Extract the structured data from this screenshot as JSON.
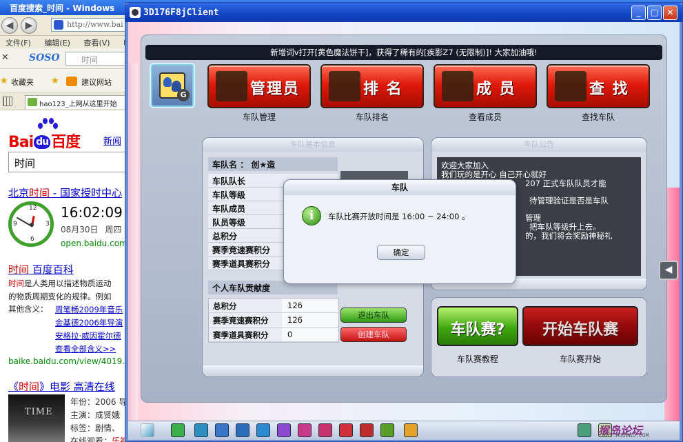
{
  "browser": {
    "title": "百度搜索_时间 - Windows",
    "address": "http://www.bai",
    "menu": [
      "文件(F)",
      "编辑(E)",
      "查看(V)",
      "收"
    ],
    "search_brand": "SOSO",
    "search_value": "时间",
    "favorites_label": "收藏夹",
    "suggested_sites": "建议网站",
    "tab_label": "hao123_上网从这里开始",
    "baidu": {
      "logo_bai": "Bai",
      "logo_du": "du",
      "logo_cn": "百度",
      "news_link": "新闻",
      "query": "时间",
      "result1_prefix": "北京",
      "result1_hl": "时间",
      "result1_rest": " - 国家授时中心",
      "clock_time": "16:02:09",
      "clock_date": "08月30日",
      "clock_weekday": "周四",
      "result1_url": "open.baidu.com",
      "result2_hl": "时间",
      "result2_rest": " 百度百科",
      "result2_line1_hl": "时间",
      "result2_line1": "是人类用以描述物质运动",
      "result2_line2": "的物质周期变化的规律。例如",
      "other_label": "其他含义：",
      "other_items": [
        "周笔畅2009年音乐",
        "金基德2006年导演",
        "安格拉·威因霍尔德"
      ],
      "other_all": "查看全部含义>>",
      "result2_url": "baike.baidu.com/view/4019.ht",
      "result3_prefix": "《",
      "result3_hl": "时间",
      "result3_rest": "》电影 高清在线",
      "poster_text": "TIME",
      "movie_year": "年份：2006 导",
      "movie_cast": "主演：成贤娥",
      "movie_tags": "标签：剧情、",
      "movie_online": "在线观看：",
      "movie_online_tail": "乐视"
    }
  },
  "game": {
    "title": "3D176F8jClient",
    "banner": "新增词v打开[黄色魔法饼干]，获得了稀有的[疾影Z7 (无限制)]! 大家加油哦!",
    "top_buttons": [
      {
        "label": "管理员",
        "caption": "车队管理"
      },
      {
        "label": "排 名",
        "caption": "车队排名"
      },
      {
        "label": "成 员",
        "caption": "查看成员"
      },
      {
        "label": "查 找",
        "caption": "查找车队"
      }
    ],
    "info_panel": {
      "header": "车队基本信息",
      "team_name": "车队名 ： 创★造",
      "rows": [
        "车队队长",
        "车队等级",
        "车队成员",
        "队员等级",
        "总积分",
        "赛季竞速赛积分",
        "赛季道具赛积分"
      ],
      "contrib_header": "个人车队贡献度",
      "contrib": [
        {
          "k": "总积分",
          "v": "126"
        },
        {
          "k": "赛季竞速赛积分",
          "v": "126"
        },
        {
          "k": "赛季道具赛积分",
          "v": "0"
        }
      ],
      "quit_button": "退出车队",
      "create_button": "创建车队"
    },
    "notice_panel": {
      "header": "车队公告",
      "lines": [
        "欢迎大家加入",
        "我们玩的是开心 自己开心就好",
        "207 正式车队队员才能",
        "待管理验证是否是车队",
        "管理",
        "把车队等级升上去。",
        "的，我们将会奖励神秘礼"
      ]
    },
    "race_panel": {
      "tutorial_button": "车队赛?",
      "tutorial_caption": "车队赛教程",
      "start_button": "开始车队赛",
      "start_caption": "车队赛开始"
    },
    "modal": {
      "title": "车队",
      "message": "车队比赛开放时间是 16:00 ~ 24:00 。",
      "ok": "确定"
    },
    "watermark": {
      "big": "猴岛论坛",
      "small": "BBS.HOUDAO.COM"
    },
    "colors": {
      "title_bar": "#1244c4",
      "top_button_red": "#e01a0a",
      "quit_green": "#2e9a14",
      "create_red": "#c41212",
      "start_dark_red": "#8f0808"
    }
  }
}
